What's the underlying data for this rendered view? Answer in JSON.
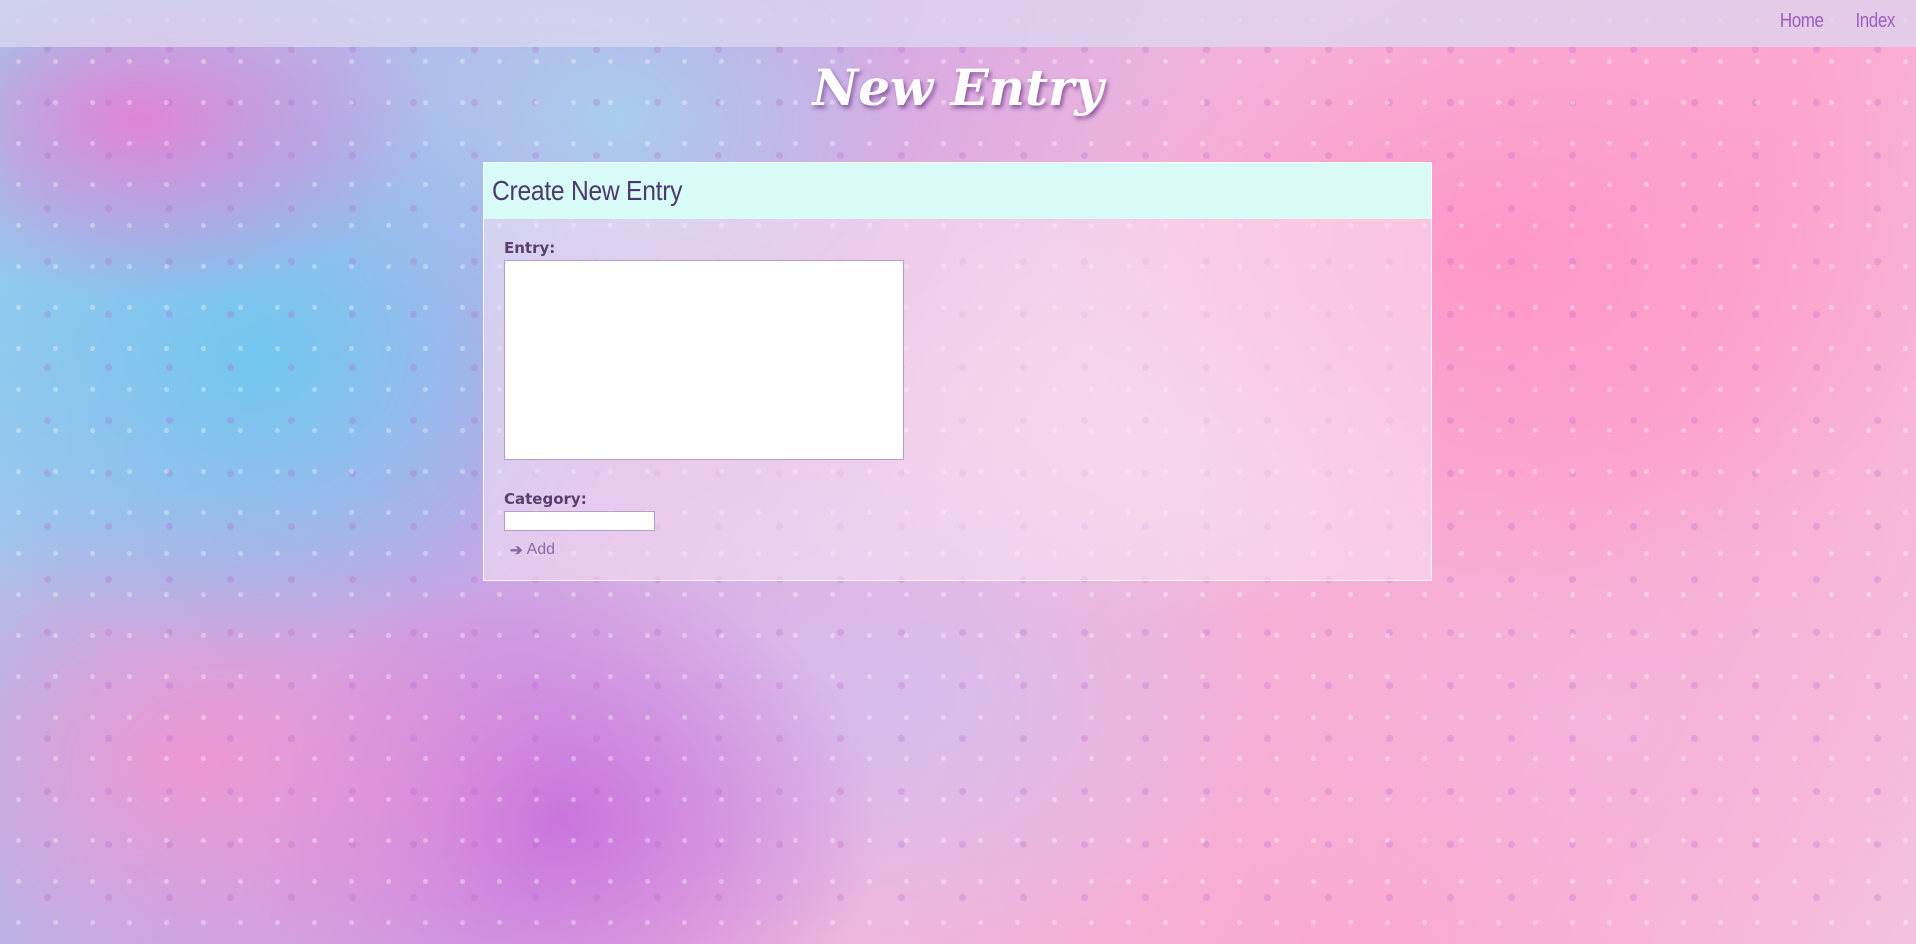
{
  "nav": {
    "links": [
      {
        "label": "Home"
      },
      {
        "label": "Index"
      }
    ]
  },
  "page": {
    "title": "New Entry"
  },
  "card": {
    "title": "Create New Entry"
  },
  "form": {
    "entry_label": "Entry:",
    "entry_value": "",
    "category_label": "Category:",
    "category_value": "",
    "add_label": "Add",
    "add_icon": "arrow-right-icon"
  },
  "colors": {
    "nav_link": "#9b5fc0",
    "card_header_bg": "#d8fbf8",
    "heading_text": "#4c3a6e",
    "label_text": "#5a3f6e",
    "button_text": "#8a6aa6"
  }
}
